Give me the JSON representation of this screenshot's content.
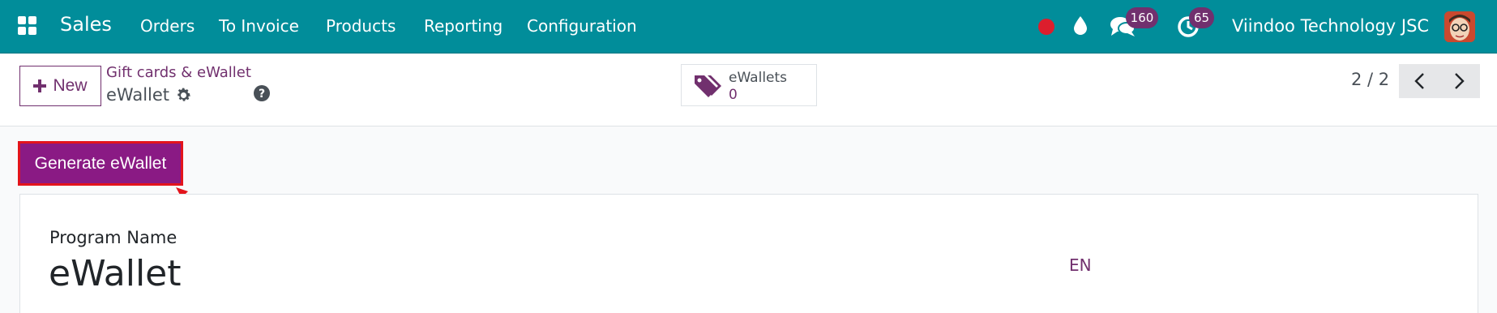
{
  "navbar": {
    "brand": "Sales",
    "menu": [
      "Orders",
      "To Invoice",
      "Products",
      "Reporting",
      "Configuration"
    ],
    "messages_count": "160",
    "activities_count": "65",
    "company": "Viindoo Technology JSC",
    "bg_color": "#018d9a"
  },
  "control_panel": {
    "new_label": "New",
    "breadcrumb_parent": "Gift cards & eWallet",
    "breadcrumb_current": "eWallet",
    "smart_button": {
      "label": "eWallets",
      "value": "0",
      "icon": "tag-icon"
    },
    "pager": "2 / 2"
  },
  "status_bar": {
    "generate_label": "Generate eWallet",
    "accent_color": "#8a1a84",
    "highlight_color": "#e3141c"
  },
  "form": {
    "field_label": "Program Name",
    "field_value": "eWallet",
    "lang_code": "EN"
  }
}
